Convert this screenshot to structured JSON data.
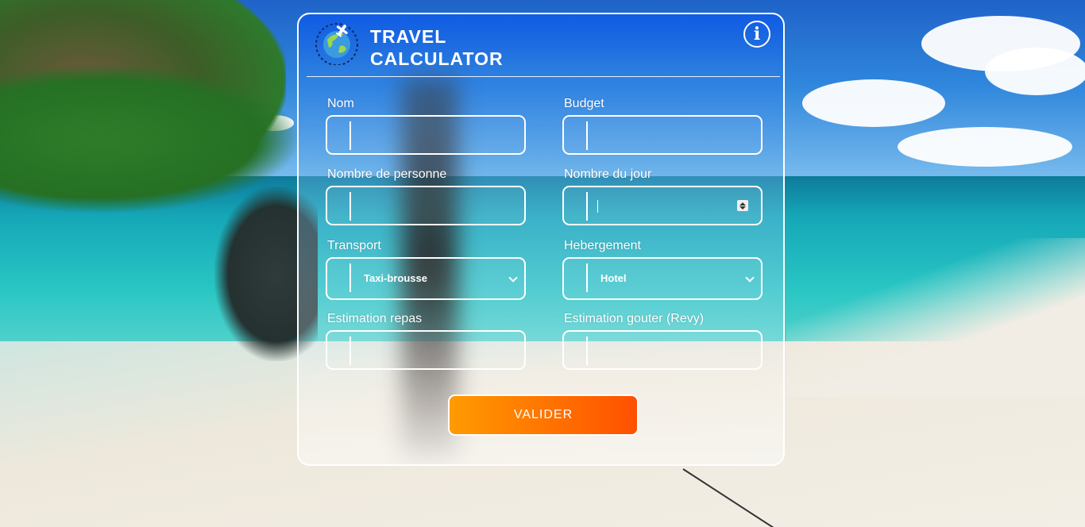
{
  "app": {
    "title_line1": "TRAVEL",
    "title_line2": "CALCULATOR",
    "info_icon": "i"
  },
  "form": {
    "nom": {
      "label": "Nom",
      "value": ""
    },
    "budget": {
      "label": "Budget",
      "value": ""
    },
    "nombre_personne": {
      "label": "Nombre de personne",
      "value": ""
    },
    "nombre_jour": {
      "label": "Nombre du jour",
      "value": ""
    },
    "transport": {
      "label": "Transport",
      "selected": "Taxi-brousse"
    },
    "hebergement": {
      "label": "Hebergement",
      "selected": "Hotel"
    },
    "repas": {
      "label": "Estimation repas",
      "value": ""
    },
    "gouter": {
      "label": "Estimation gouter (Revy)",
      "value": ""
    },
    "submit_label": "VALIDER"
  },
  "colors": {
    "button_start": "#ff9b00",
    "button_end": "#ff5000",
    "header_blue": "#0f5ce6"
  },
  "icons": {
    "logo": "globe-airplane-icon",
    "info": "info-icon",
    "dropdown": "chevron-down-icon",
    "spinner": "number-spinner-icon"
  }
}
